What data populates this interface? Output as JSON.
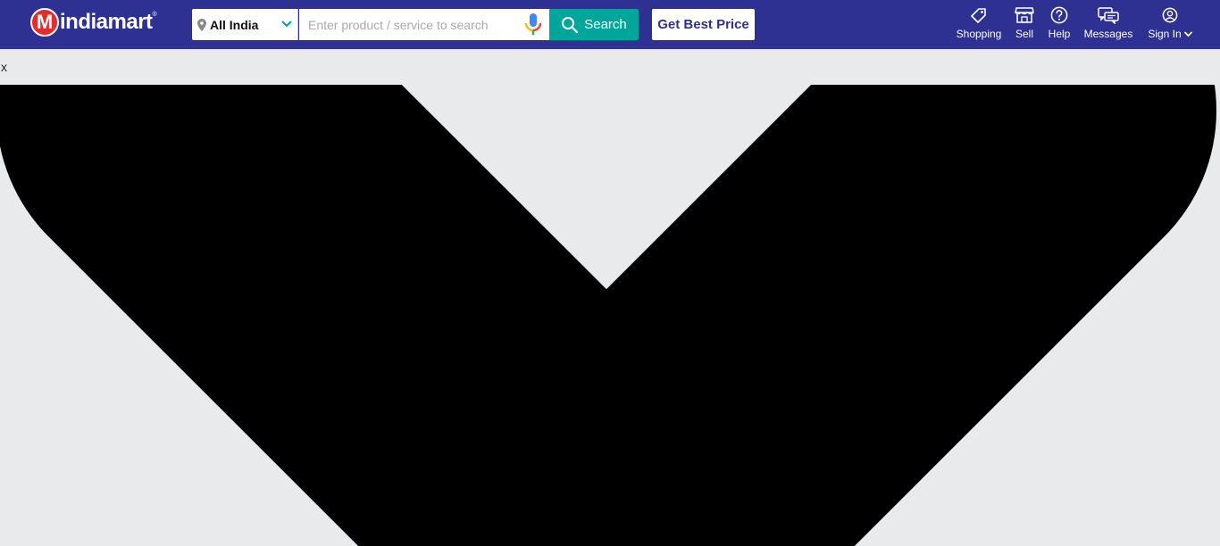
{
  "brand": {
    "logo_letter": "M",
    "logo_text": "indiamart",
    "logo_mark": "®"
  },
  "location": {
    "value": "All India",
    "icon": "location-pin-icon"
  },
  "search": {
    "placeholder": "Enter product / service to search",
    "value": "",
    "button_label": "Search"
  },
  "cta": {
    "best_price_label": "Get Best Price"
  },
  "nav": {
    "shopping": "Shopping",
    "sell": "Sell",
    "help": "Help",
    "messages": "Messages",
    "sign_in": "Sign In"
  },
  "overlay": {
    "close_label": "x",
    "icon": "chevron-down-icon"
  },
  "colors": {
    "header_bg": "#2e3192",
    "accent": "#00a699",
    "page_bg": "#e9eaec",
    "logo_red": "#e52b2b"
  }
}
